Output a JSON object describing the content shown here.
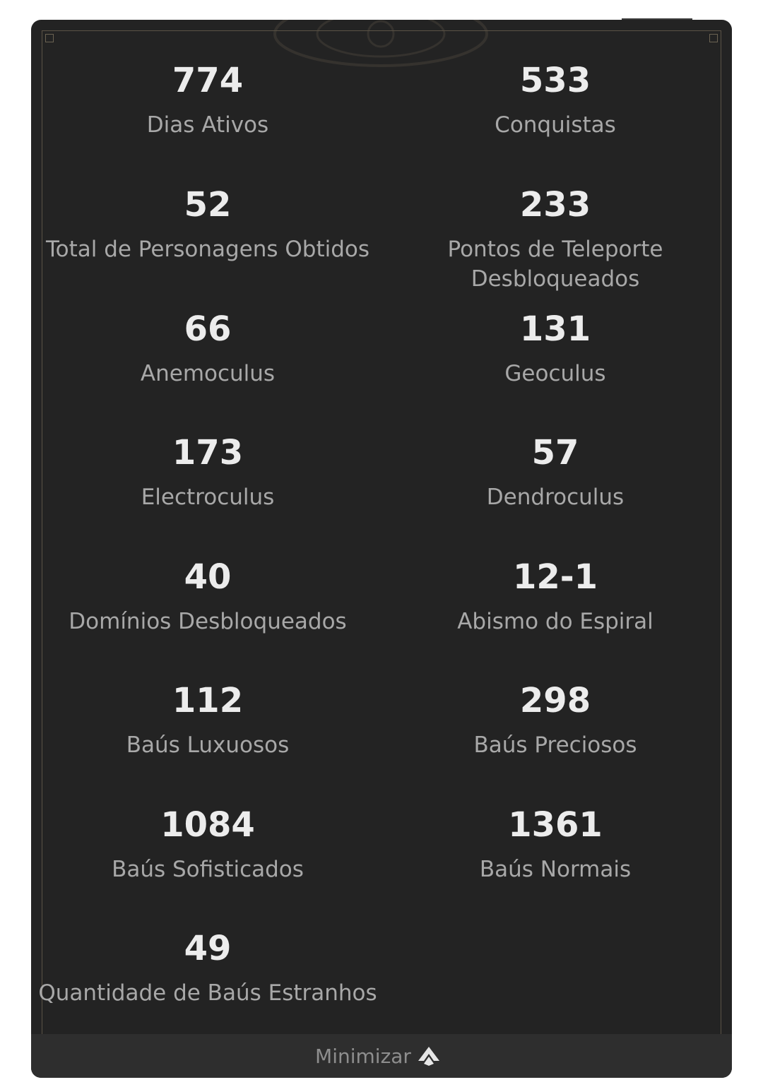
{
  "stats": [
    {
      "value": "774",
      "label": "Dias Ativos"
    },
    {
      "value": "533",
      "label": "Conquistas"
    },
    {
      "value": "52",
      "label": "Total de Personagens Obtidos"
    },
    {
      "value": "233",
      "label": "Pontos de Teleporte Desbloqueados"
    },
    {
      "value": "66",
      "label": "Anemoculus"
    },
    {
      "value": "131",
      "label": "Geoculus"
    },
    {
      "value": "173",
      "label": "Electroculus"
    },
    {
      "value": "57",
      "label": "Dendroculus"
    },
    {
      "value": "40",
      "label": "Domínios Desbloqueados"
    },
    {
      "value": "12-1",
      "label": "Abismo do Espiral"
    },
    {
      "value": "112",
      "label": "Baús Luxuosos"
    },
    {
      "value": "298",
      "label": "Baús Preciosos"
    },
    {
      "value": "1084",
      "label": "Baús Sofisticados"
    },
    {
      "value": "1361",
      "label": "Baús Normais"
    },
    {
      "value": "49",
      "label": "Quantidade de Baús Estranhos"
    }
  ],
  "footer": {
    "label": "Minimizar",
    "icon": "chevron-up-icon"
  },
  "colors": {
    "card_background": "#232323",
    "value_text": "#ececec",
    "label_text": "#a8a8a8",
    "frame_border": "#5b5346",
    "footer_background": "#2e2e2e"
  }
}
